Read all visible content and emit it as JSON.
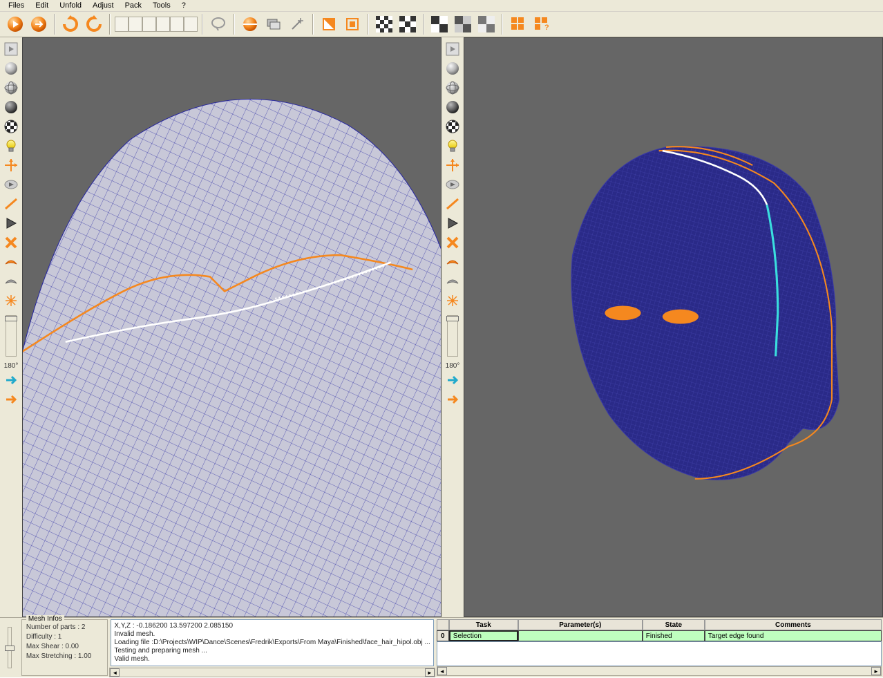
{
  "menu": {
    "items": [
      "Files",
      "Edit",
      "Unfold",
      "Adjust",
      "Pack",
      "Tools",
      "?"
    ]
  },
  "toolbar": {
    "items": [
      {
        "name": "unfold-right-icon",
        "type": "orange-arrow"
      },
      {
        "name": "unfold-icon",
        "type": "orange-arrow2"
      },
      {
        "name": "sep"
      },
      {
        "name": "rotate-left-icon",
        "type": "orange-swirl"
      },
      {
        "name": "rotate-right-icon",
        "type": "orange-swirl2"
      },
      {
        "name": "sep"
      },
      {
        "name": "boxes"
      },
      {
        "name": "sep"
      },
      {
        "name": "lasso-icon",
        "type": "grey-loop"
      },
      {
        "name": "sep"
      },
      {
        "name": "sphere-cut-icon",
        "type": "orange-sphere"
      },
      {
        "name": "stack-icon",
        "type": "grey-stack"
      },
      {
        "name": "wand-icon",
        "type": "grey-wand"
      },
      {
        "name": "sep"
      },
      {
        "name": "half-icon",
        "type": "orange-half"
      },
      {
        "name": "square-icon",
        "type": "orange-square"
      },
      {
        "name": "sep"
      },
      {
        "name": "checker-a-icon",
        "type": "checker"
      },
      {
        "name": "checker-b-icon",
        "type": "checker"
      },
      {
        "name": "sep"
      },
      {
        "name": "checker-big-a-icon",
        "type": "checker-big"
      },
      {
        "name": "checker-big-b-icon",
        "type": "checker-big"
      },
      {
        "name": "checker-big-c-icon",
        "type": "checker-big"
      },
      {
        "name": "sep"
      },
      {
        "name": "grid-orange-icon",
        "type": "orange-grid"
      },
      {
        "name": "grid-help-icon",
        "type": "orange-help"
      }
    ]
  },
  "side": [
    {
      "name": "expand-icon",
      "type": "grey-arrow"
    },
    {
      "name": "sphere1-icon",
      "type": "grey-sphere"
    },
    {
      "name": "globe-icon",
      "type": "grey-globe"
    },
    {
      "name": "sphere-dark-icon",
      "type": "dark-sphere"
    },
    {
      "name": "checker-sphere-icon",
      "type": "checker-sphere"
    },
    {
      "name": "light-icon",
      "type": "bulb"
    },
    {
      "name": "axis-icon",
      "type": "orange-axis"
    },
    {
      "name": "play-grey-icon",
      "type": "grey-play"
    },
    {
      "name": "edge-icon",
      "type": "orange-edge"
    },
    {
      "name": "play-dark-icon",
      "type": "dark-play"
    },
    {
      "name": "x-icon",
      "type": "orange-x"
    },
    {
      "name": "shell-icon",
      "type": "orange-shell"
    },
    {
      "name": "shell-grey-icon",
      "type": "grey-shell"
    },
    {
      "name": "burst-icon",
      "type": "orange-burst"
    }
  ],
  "sliderLabel": "180°",
  "meshInfos": {
    "title": "Mesh Infos",
    "lines": [
      "Number of parts : 2",
      "Difficulty      : 1",
      "Max Shear   : 0.00",
      "Max Stretching : 1.00"
    ]
  },
  "log": {
    "lines": [
      "X,Y,Z : -0.186200 13.597200 2.085150",
      "Invalid mesh.",
      "Loading file :D:\\Projects\\WIP\\Dance\\Scenes\\Fredrik\\Exports\\From Maya\\Finished\\face_hair_hipol.obj ...",
      "Testing and preparing mesh ...",
      "Valid mesh."
    ]
  },
  "tasks": {
    "headers": [
      "",
      "Task",
      "Parameter(s)",
      "State",
      "Comments"
    ],
    "row": {
      "index": "0",
      "task": "Selection",
      "params": "",
      "state": "Finished",
      "comments": "Target edge found"
    }
  }
}
